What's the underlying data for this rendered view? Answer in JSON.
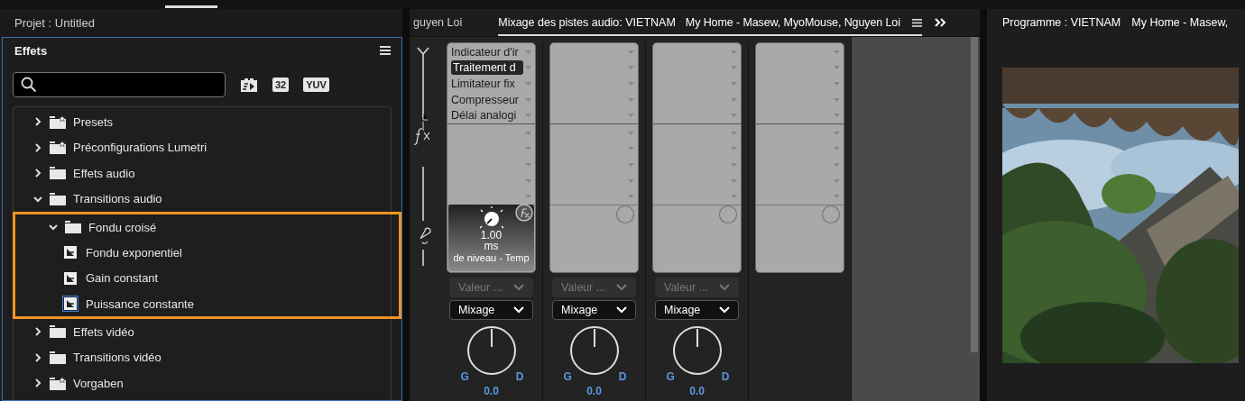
{
  "project_panel": {
    "title": "Projet : Untitled"
  },
  "effects_panel": {
    "title": "Effets",
    "badges": [
      {
        "kind": "accelerated"
      },
      {
        "kind": "text",
        "label": "32"
      },
      {
        "kind": "text",
        "label": "YUV"
      }
    ],
    "tree": [
      {
        "kind": "preset-folder",
        "label": "Presets",
        "expanded": false
      },
      {
        "kind": "preset-folder",
        "label": "Préconfigurations Lumetri",
        "expanded": false
      },
      {
        "kind": "folder",
        "label": "Effets audio",
        "expanded": false
      },
      {
        "kind": "folder",
        "label": "Transitions audio",
        "expanded": true,
        "children": [
          {
            "kind": "folder",
            "label": "Fondu croisé",
            "expanded": true,
            "highlighted": true,
            "children": [
              {
                "kind": "effect",
                "label": "Fondu exponentiel",
                "selected": false
              },
              {
                "kind": "effect",
                "label": "Gain constant",
                "selected": false
              },
              {
                "kind": "effect",
                "label": "Puissance constante",
                "selected": true
              }
            ]
          }
        ]
      },
      {
        "kind": "folder",
        "label": "Effets vidéo",
        "expanded": false
      },
      {
        "kind": "folder",
        "label": "Transitions vidéo",
        "expanded": false
      },
      {
        "kind": "preset-folder",
        "label": "Vorgaben",
        "expanded": false
      }
    ]
  },
  "mixer": {
    "tabs": [
      {
        "label": "guyen Loi",
        "selected": false
      },
      {
        "label": "Mixage des pistes audio: VIETNAM",
        "subtitle": "My Home - Masew, MyoMouse, Nguyen Loi",
        "selected": true
      }
    ],
    "tracks": [
      {
        "kind": "full",
        "effects": [
          {
            "label": "Indicateur d'ir",
            "selected": false
          },
          {
            "label": "Traitement d",
            "selected": true
          },
          {
            "label": "Limitateur fix",
            "selected": false
          },
          {
            "label": "Compresseur",
            "selected": false
          },
          {
            "label": "Délai analogi",
            "selected": false
          }
        ],
        "param": {
          "value": "1.00",
          "unit": "ms",
          "name": "de niveau - Temp"
        },
        "automation": {
          "label": "Valeur ...",
          "disabled": true
        },
        "mode": "Mixage",
        "pan": {
          "left": "G",
          "right": "D",
          "reading": "0.0"
        }
      },
      {
        "kind": "full",
        "automation": {
          "label": "Valeur ...",
          "disabled": true
        },
        "mode": "Mixage",
        "pan": {
          "left": "G",
          "right": "D",
          "reading": "0.0"
        }
      },
      {
        "kind": "full",
        "automation": {
          "label": "Valeur ...",
          "disabled": true
        },
        "mode": "Mixage",
        "pan": {
          "left": "G",
          "right": "D",
          "reading": "0.0"
        }
      },
      {
        "kind": "rack"
      }
    ]
  },
  "program_monitor": {
    "title": "Programme : VIETNAM",
    "subtitle": "My Home - Masew,"
  }
}
